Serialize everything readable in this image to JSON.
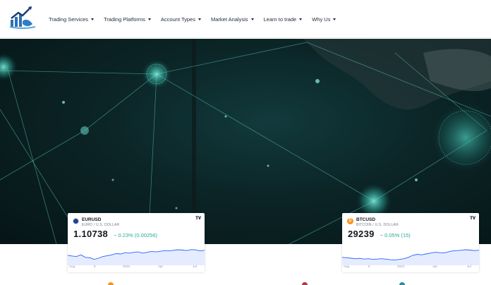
{
  "nav": {
    "items": [
      {
        "label": "Trading Services"
      },
      {
        "label": "Trading Platforms"
      },
      {
        "label": "Account Types"
      },
      {
        "label": "Market Analysis"
      },
      {
        "label": "Learn to trade"
      },
      {
        "label": "Why Us"
      }
    ]
  },
  "widgets": [
    {
      "symbol": "EURUSD",
      "name": "EURO / U.S. DOLLAR",
      "price": "1.10738",
      "change": "− 0.23% (0.00256)",
      "axis": [
        "Aug",
        "6",
        "2023",
        "Apr",
        "Jul"
      ],
      "trend": [
        0.42,
        0.38,
        0.35,
        0.45,
        0.3,
        0.28,
        0.18,
        0.25,
        0.35,
        0.4,
        0.45,
        0.52,
        0.5,
        0.58,
        0.55,
        0.6,
        0.62,
        0.55,
        0.6,
        0.65,
        0.62,
        0.66,
        0.7,
        0.68,
        0.72,
        0.75,
        0.73,
        0.7,
        0.76,
        0.74,
        0.68,
        0.72
      ]
    },
    {
      "symbol": "BTCUSD",
      "name": "BITCOIN / U.S. DOLLAR",
      "price": "29239",
      "change": "− 0.05% (15)",
      "axis": [
        "Aug",
        "6",
        "2023",
        "Apr",
        "Jul"
      ],
      "trend": [
        0.3,
        0.28,
        0.25,
        0.22,
        0.24,
        0.2,
        0.22,
        0.18,
        0.2,
        0.22,
        0.19,
        0.16,
        0.15,
        0.18,
        0.22,
        0.3,
        0.42,
        0.48,
        0.45,
        0.5,
        0.55,
        0.6,
        0.58,
        0.56,
        0.62,
        0.68,
        0.7,
        0.72,
        0.75,
        0.73,
        0.7,
        0.72
      ]
    }
  ],
  "colors": {
    "accent": "#22ab94",
    "line": "#2962ff",
    "hero": "#0b2426",
    "nav_text": "#1f2a3a"
  }
}
